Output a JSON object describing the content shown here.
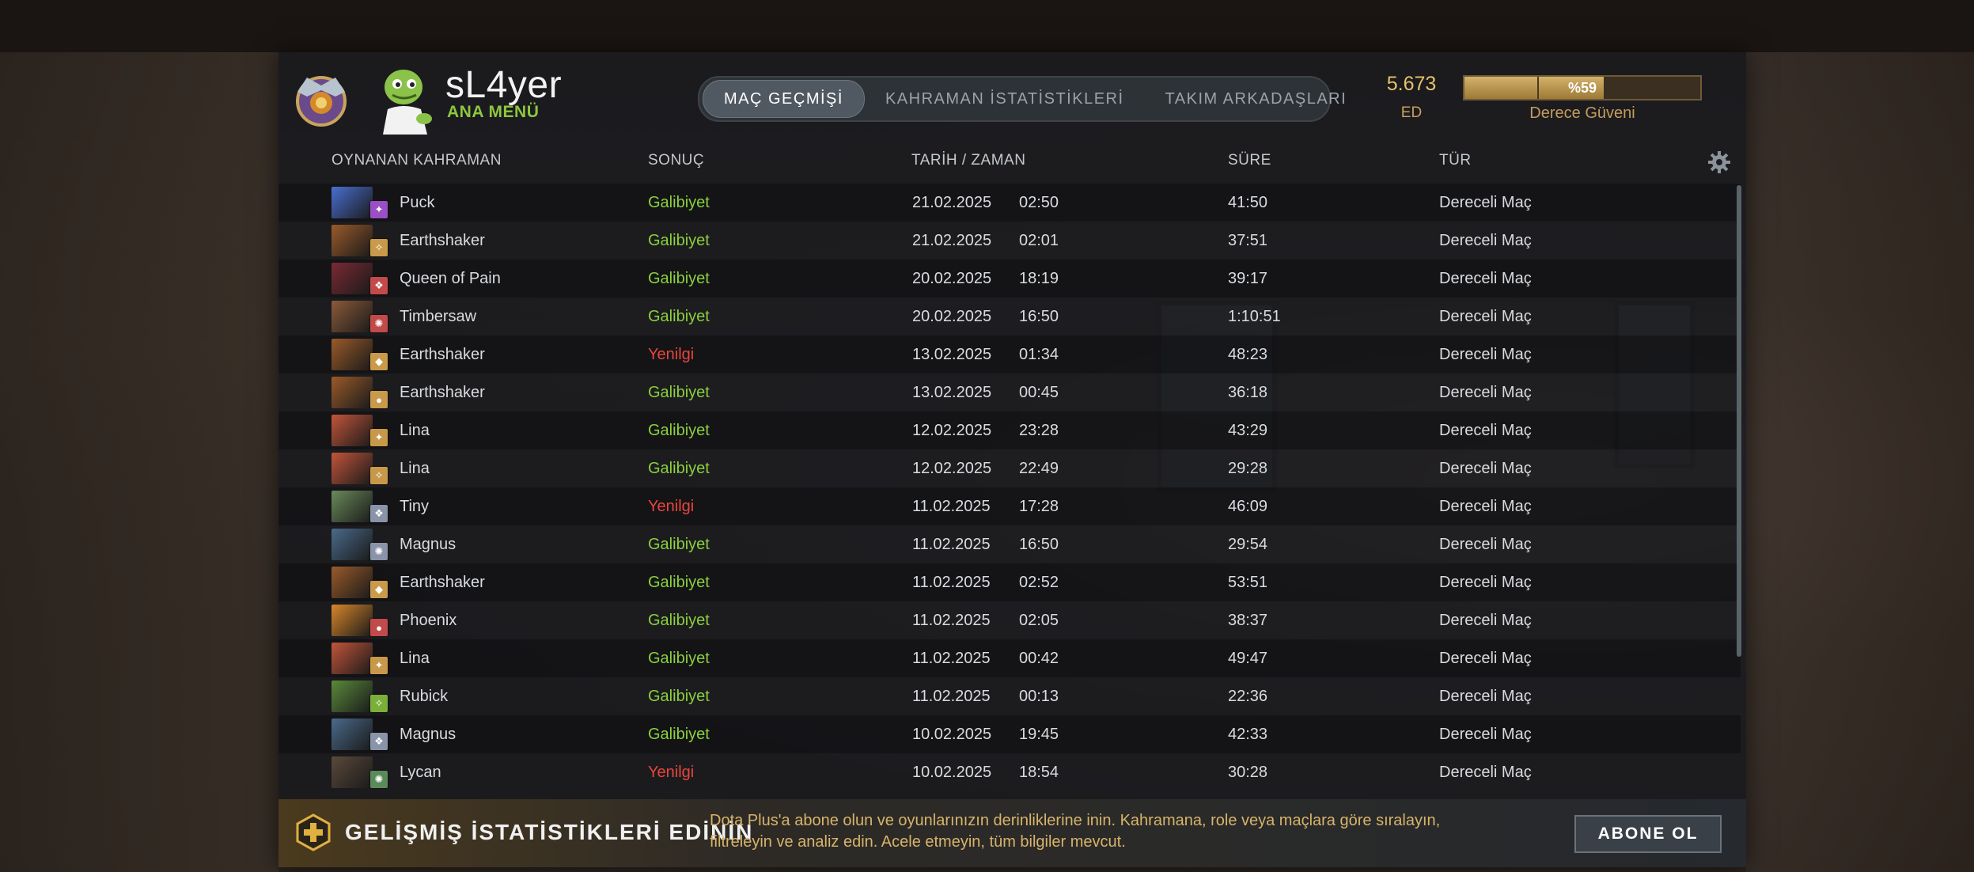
{
  "profile": {
    "name": "sL4yer",
    "menu_label": "ANA MENÜ"
  },
  "tabs": [
    {
      "label": "MAÇ GEÇMİŞİ",
      "active": true
    },
    {
      "label": "KAHRAMAN İSTATİSTİKLERİ",
      "active": false
    },
    {
      "label": "TAKIM ARKADAŞLARI",
      "active": false
    }
  ],
  "rating": {
    "value": "5.673",
    "label": "ED",
    "confidence_text": "%59",
    "confidence_percent": 59,
    "confidence_label": "Derece Güveni"
  },
  "columns": {
    "hero": "OYNANAN KAHRAMAN",
    "result": "SONUÇ",
    "datetime": "TARİH / ZAMAN",
    "duration": "SÜRE",
    "type": "TÜR"
  },
  "matches": [
    {
      "hero": "Puck",
      "result": "Galibiyet",
      "win": true,
      "date": "21.02.2025",
      "time": "02:50",
      "duration": "41:50",
      "type": "Dereceli Maç",
      "portrait": "#4a6fd1",
      "attr_color": "#9a4fc4"
    },
    {
      "hero": "Earthshaker",
      "result": "Galibiyet",
      "win": true,
      "date": "21.02.2025",
      "time": "02:01",
      "duration": "37:51",
      "type": "Dereceli Maç",
      "portrait": "#9a5a2a",
      "attr_color": "#c89a4a"
    },
    {
      "hero": "Queen of Pain",
      "result": "Galibiyet",
      "win": true,
      "date": "20.02.2025",
      "time": "18:19",
      "duration": "39:17",
      "type": "Dereceli Maç",
      "portrait": "#7a2a34",
      "attr_color": "#c24a4a"
    },
    {
      "hero": "Timbersaw",
      "result": "Galibiyet",
      "win": true,
      "date": "20.02.2025",
      "time": "16:50",
      "duration": "1:10:51",
      "type": "Dereceli Maç",
      "portrait": "#8a5a3a",
      "attr_color": "#c24a4a"
    },
    {
      "hero": "Earthshaker",
      "result": "Yenilgi",
      "win": false,
      "date": "13.02.2025",
      "time": "01:34",
      "duration": "48:23",
      "type": "Dereceli Maç",
      "portrait": "#9a5a2a",
      "attr_color": "#c89a4a"
    },
    {
      "hero": "Earthshaker",
      "result": "Galibiyet",
      "win": true,
      "date": "13.02.2025",
      "time": "00:45",
      "duration": "36:18",
      "type": "Dereceli Maç",
      "portrait": "#9a5a2a",
      "attr_color": "#c89a4a"
    },
    {
      "hero": "Lina",
      "result": "Galibiyet",
      "win": true,
      "date": "12.02.2025",
      "time": "23:28",
      "duration": "43:29",
      "type": "Dereceli Maç",
      "portrait": "#c2553a",
      "attr_color": "#c8984a"
    },
    {
      "hero": "Lina",
      "result": "Galibiyet",
      "win": true,
      "date": "12.02.2025",
      "time": "22:49",
      "duration": "29:28",
      "type": "Dereceli Maç",
      "portrait": "#c2553a",
      "attr_color": "#c8984a"
    },
    {
      "hero": "Tiny",
      "result": "Yenilgi",
      "win": false,
      "date": "11.02.2025",
      "time": "17:28",
      "duration": "46:09",
      "type": "Dereceli Maç",
      "portrait": "#6a8a5a",
      "attr_color": "#8a94a8"
    },
    {
      "hero": "Magnus",
      "result": "Galibiyet",
      "win": true,
      "date": "11.02.2025",
      "time": "16:50",
      "duration": "29:54",
      "type": "Dereceli Maç",
      "portrait": "#4a6a8a",
      "attr_color": "#8a94a8"
    },
    {
      "hero": "Earthshaker",
      "result": "Galibiyet",
      "win": true,
      "date": "11.02.2025",
      "time": "02:52",
      "duration": "53:51",
      "type": "Dereceli Maç",
      "portrait": "#9a5a2a",
      "attr_color": "#c89a4a"
    },
    {
      "hero": "Phoenix",
      "result": "Galibiyet",
      "win": true,
      "date": "11.02.2025",
      "time": "02:05",
      "duration": "38:37",
      "type": "Dereceli Maç",
      "portrait": "#d8862a",
      "attr_color": "#c24a4a"
    },
    {
      "hero": "Lina",
      "result": "Galibiyet",
      "win": true,
      "date": "11.02.2025",
      "time": "00:42",
      "duration": "49:47",
      "type": "Dereceli Maç",
      "portrait": "#c2553a",
      "attr_color": "#c8984a"
    },
    {
      "hero": "Rubick",
      "result": "Galibiyet",
      "win": true,
      "date": "11.02.2025",
      "time": "00:13",
      "duration": "22:36",
      "type": "Dereceli Maç",
      "portrait": "#5a8a3a",
      "attr_color": "#7ab03a"
    },
    {
      "hero": "Magnus",
      "result": "Galibiyet",
      "win": true,
      "date": "10.02.2025",
      "time": "19:45",
      "duration": "42:33",
      "type": "Dereceli Maç",
      "portrait": "#4a6a8a",
      "attr_color": "#8a94a8"
    },
    {
      "hero": "Lycan",
      "result": "Yenilgi",
      "win": false,
      "date": "10.02.2025",
      "time": "18:54",
      "duration": "30:28",
      "type": "Dereceli Maç",
      "portrait": "#5a4a3a",
      "attr_color": "#5a8a5a"
    }
  ],
  "promo": {
    "title": "GELİŞMİŞ İSTATİSTİKLERİ EDİNİN",
    "text": "Dota Plus'a abone olun ve oyunlarınızın derinliklerine inin. Kahramana, role veya maçlara göre sıralayın, filtreleyin ve analiz edin. Acele etmeyin, tüm bilgiler mevcut.",
    "button": "ABONE OL"
  },
  "colors": {
    "win": "#8bd13d",
    "loss": "#e8453c",
    "gold": "#e6c36b"
  }
}
